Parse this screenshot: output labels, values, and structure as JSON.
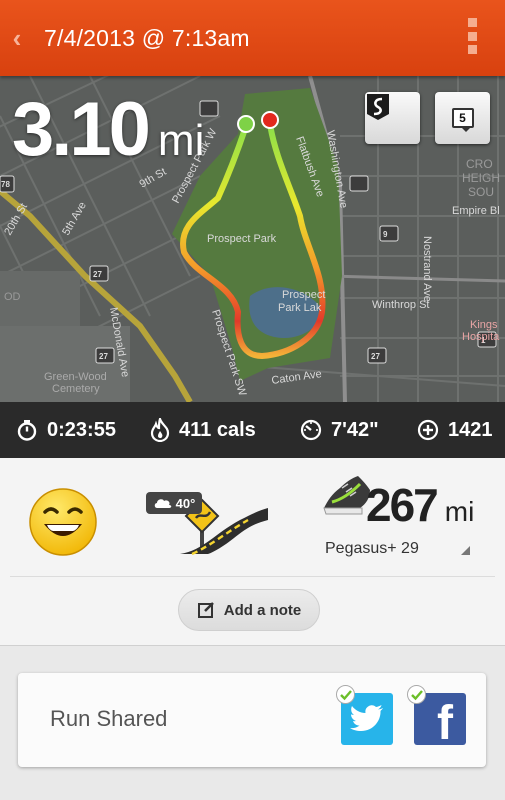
{
  "header": {
    "back_icon": "chevron-left-icon",
    "title": "7/4/2013 @ 7:13am",
    "menu_icon": "overflow-menu-icon"
  },
  "map": {
    "distance_value": "3.10",
    "distance_unit": "mi",
    "labels": {
      "prospect_park_w": "Prospect Park W",
      "prospect_park": "Prospect Park",
      "prospect_park_lake_1": "Prospect",
      "prospect_park_lake_2": "Park Lak",
      "prospect_park_sw": "Prospect Park SW",
      "flatbush_ave": "Flatbush Ave",
      "washington_ave": "Washington Ave",
      "empire_blvd": "Empire Bl",
      "nostrand_ave": "Nostrand Ave",
      "winthrop_st": "Winthrop St",
      "kings_1": "Kings",
      "kings_2": "Hospita",
      "crown_1": "CRO",
      "crown_2": "HEIGH",
      "crown_3": "SOU",
      "ninth_st": "9th St",
      "fifth_ave": "5th Ave",
      "twentieth_st": "20th St",
      "mcdonald_ave": "McDonald Ave",
      "caton_ave": "Caton Ave",
      "greenwood_1": "Green-Wood",
      "greenwood_2": "Cemetery",
      "od": "OD",
      "shield_27": "27",
      "shield_278": "78",
      "shield_9": "9",
      "shield_1": "1"
    },
    "route_button_icon": "route-icon",
    "splits_button_label": "5",
    "splits_button_icon": "splits-icon"
  },
  "stats": {
    "duration": "0:23:55",
    "duration_icon": "stopwatch-icon",
    "calories": "411 cals",
    "calories_icon": "flame-icon",
    "pace": "7'42\"",
    "pace_icon": "speedometer-icon",
    "fuel": "1421",
    "fuel_icon": "fuel-plus-icon"
  },
  "summary": {
    "mood_icon": "smiley-icon",
    "weather_icon": "cloud-icon",
    "temperature": "40°",
    "terrain_icon": "road-icon",
    "shoe_icon": "shoe-icon",
    "shoe_miles": "267",
    "shoe_unit": "mi",
    "shoe_name": "Pegasus+ 29",
    "add_note_label": "Add a note",
    "add_note_icon": "edit-note-icon"
  },
  "share": {
    "label": "Run Shared",
    "twitter_icon": "twitter-icon",
    "facebook_label": "f",
    "check_icon": "check-icon"
  },
  "colors": {
    "header": "#e24a16",
    "stats_bar": "#2a2a2a",
    "route_good": "#e8e82e",
    "route_mid": "#f59a2a",
    "route_slow": "#e23a2a",
    "twitter": "#27b4ea",
    "facebook": "#3c5aa0"
  }
}
